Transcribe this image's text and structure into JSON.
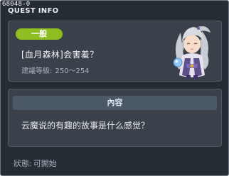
{
  "window": {
    "id": "68048-0",
    "title": "QUEST INFO"
  },
  "quest": {
    "category": "一般",
    "name": "[血月森林]会害羞？",
    "level_label": "建議等級:",
    "level_range": "250～254",
    "npc_icon": "white-haired-npc-portrait"
  },
  "content": {
    "header": "內容",
    "text": "云魔说的有趣的故事是什么感觉？"
  },
  "status": {
    "label": "狀態:",
    "value": "可開始"
  },
  "colors": {
    "window_bg": "#262c34",
    "panel_bg": "#3b414a",
    "badge_green": "#8fbe23",
    "header_bar": "#4a5868"
  }
}
